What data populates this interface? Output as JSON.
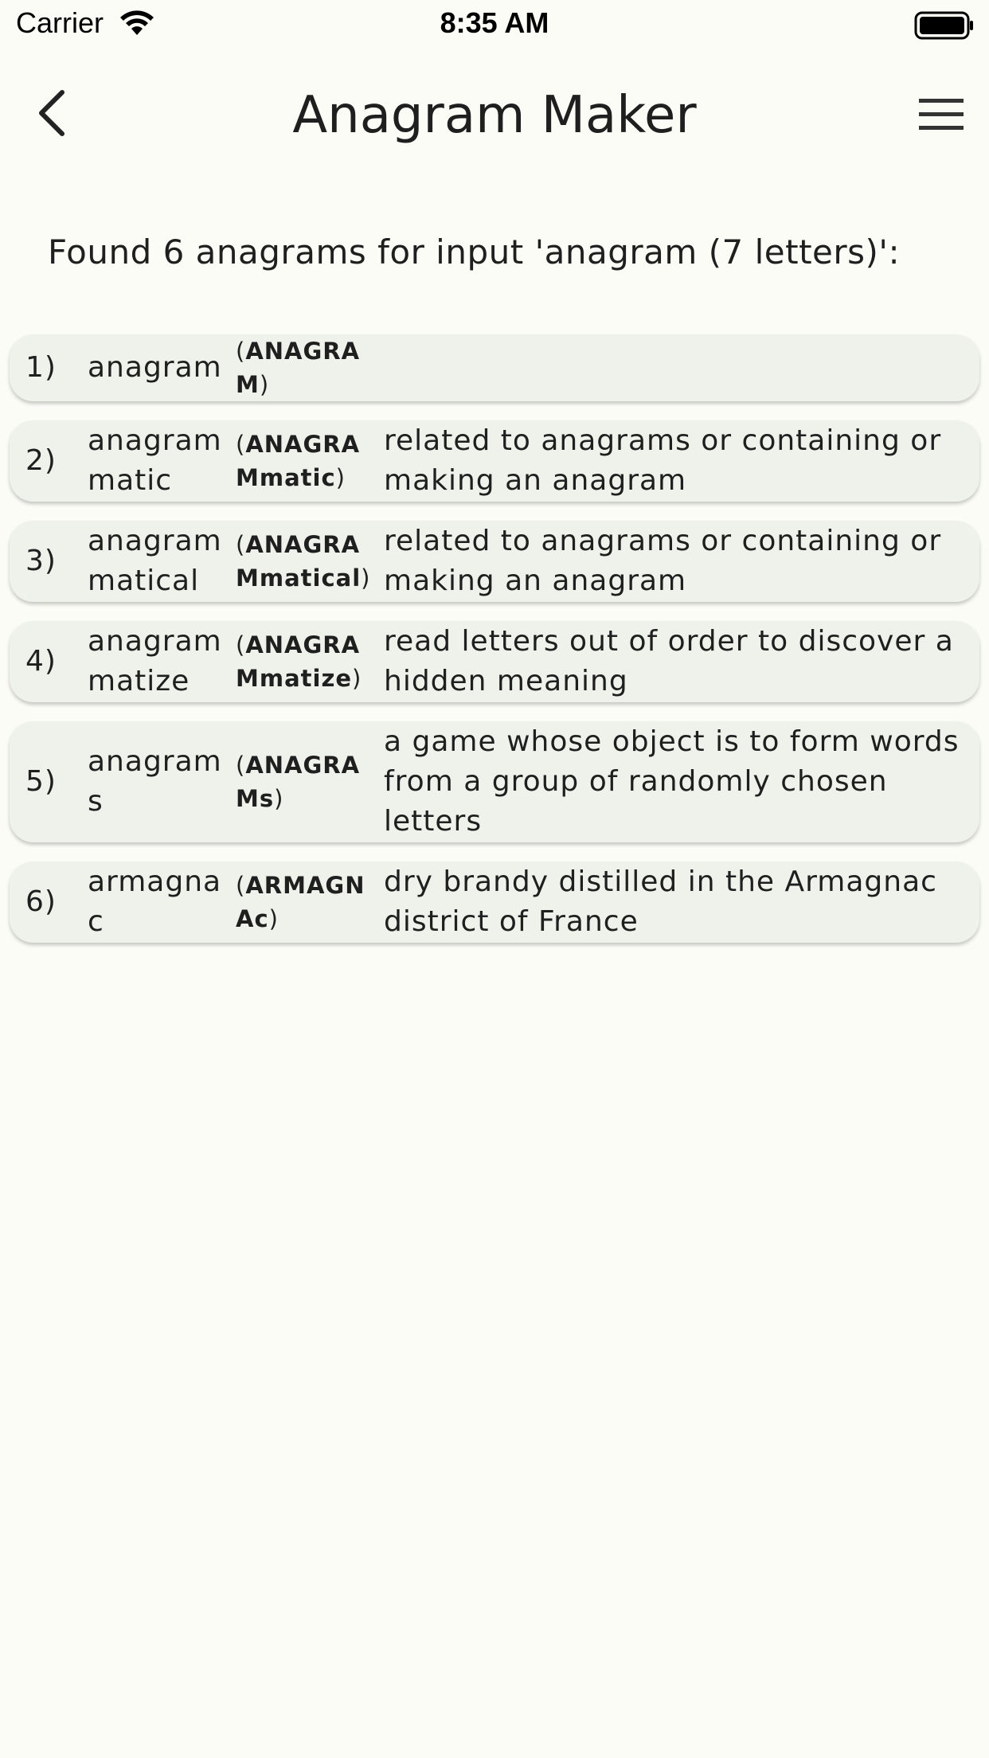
{
  "status_bar": {
    "carrier": "Carrier",
    "time": "8:35 AM"
  },
  "app_bar": {
    "title": "Anagram Maker"
  },
  "summary": "Found 6 anagrams for input 'anagram (7 letters)':",
  "results": [
    {
      "num": "1)",
      "word": "anagram",
      "code_open": "(",
      "code_bold": "ANAGRAM",
      "code_rest": "",
      "code_close": ")",
      "definition": ""
    },
    {
      "num": "2)",
      "word": "anagrammatic",
      "code_open": "(",
      "code_bold": "ANAGRAMmatic",
      "code_rest": "",
      "code_close": ")",
      "definition": "related to anagrams or containing or making an anagram"
    },
    {
      "num": "3)",
      "word": "anagrammatical",
      "code_open": "(",
      "code_bold": "ANAGRAMmatical",
      "code_rest": "",
      "code_close": ")",
      "definition": "related to anagrams or containing or making an anagram"
    },
    {
      "num": "4)",
      "word": "anagrammatize",
      "code_open": "(",
      "code_bold": "ANAGRAMmatize",
      "code_rest": "",
      "code_close": ")",
      "definition": "read letters out of order to discover a hidden meaning"
    },
    {
      "num": "5)",
      "word": "anagrams",
      "code_open": "(",
      "code_bold": "ANAGRAMs",
      "code_rest": "",
      "code_close": ")",
      "definition": "a game whose object is to form words from a group of randomly chosen letters"
    },
    {
      "num": "6)",
      "word": "armagnac",
      "code_open": "(",
      "code_bold": "ARMAGNAc",
      "code_rest": "",
      "code_close": ")",
      "definition": "dry brandy distilled in the Armagnac district of France"
    }
  ]
}
